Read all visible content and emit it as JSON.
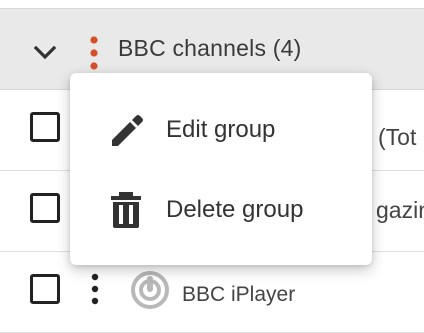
{
  "group": {
    "title": "BBC channels (4)",
    "accent_color": "#d4502a"
  },
  "rows": [
    {
      "truncated_text": "(Tot"
    },
    {
      "truncated_text": "gazin"
    },
    {
      "name": "BBC iPlayer"
    }
  ],
  "context_menu": {
    "items": [
      {
        "label": "Edit group",
        "icon": "pencil-icon"
      },
      {
        "label": "Delete group",
        "icon": "trash-icon"
      }
    ]
  }
}
